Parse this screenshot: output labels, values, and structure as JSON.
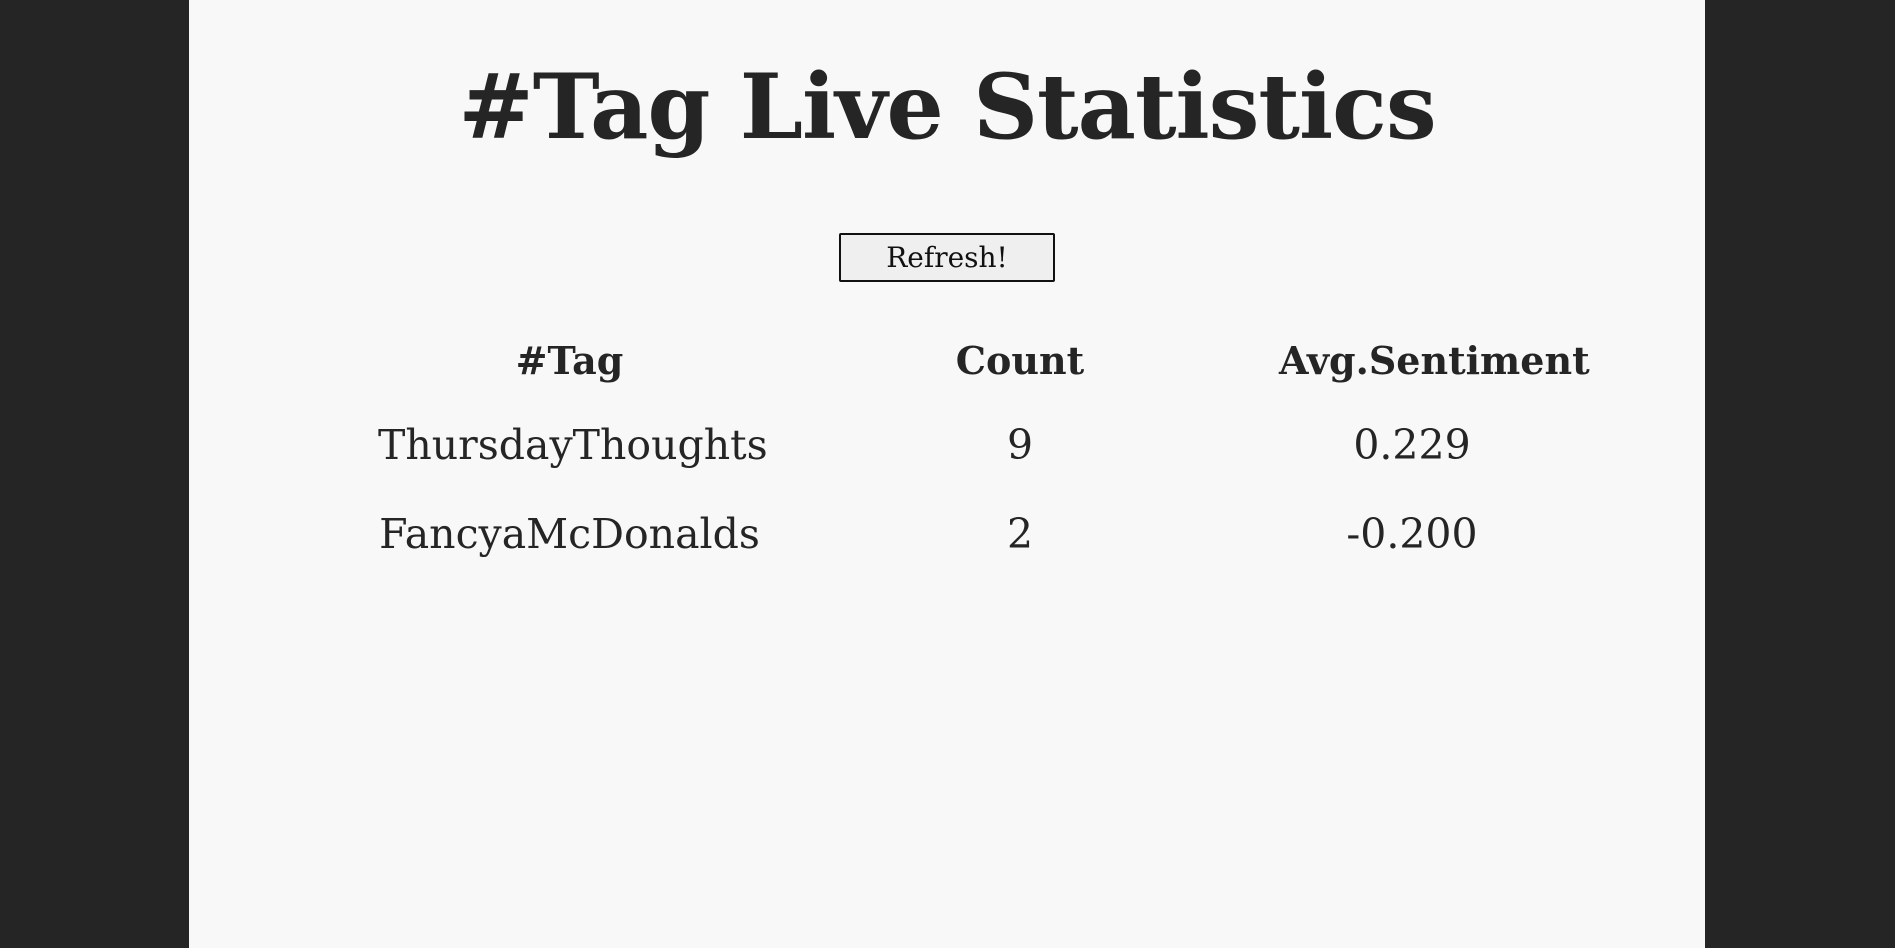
{
  "page": {
    "title": "#Tag Live Statistics",
    "refresh_label": "Refresh!"
  },
  "table": {
    "headers": {
      "tag": "#Tag",
      "count": "Count",
      "sentiment": "Avg.Sentiment"
    },
    "rows": [
      {
        "tag": "ThursdayThoughts",
        "count": "9",
        "sentiment": "0.229"
      },
      {
        "tag": "FancyaMcDonalds",
        "count": "2",
        "sentiment": "-0.200"
      }
    ]
  },
  "colors": {
    "outer_background": "#252525",
    "page_background": "#f8f8f8",
    "text": "#252525"
  }
}
